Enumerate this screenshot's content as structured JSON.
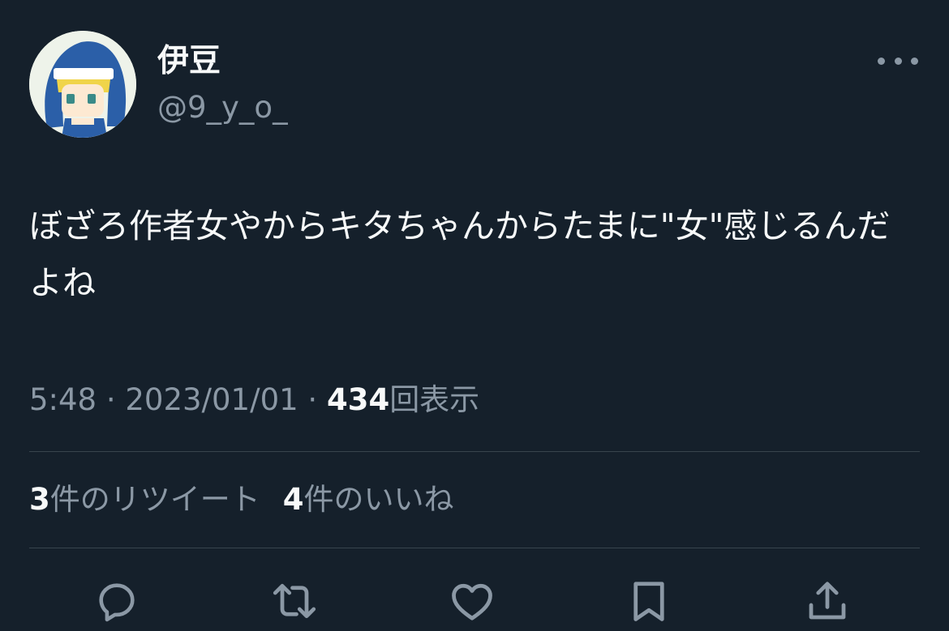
{
  "user": {
    "display_name": "伊豆",
    "handle": "@9_y_o_"
  },
  "tweet": {
    "text": "ぼざろ作者女やからキタちゃんからたまに\"女\"感じるんだよね",
    "time": "5:48",
    "separator": "·",
    "date": "2023/01/01",
    "views_count": "434",
    "views_label": "回表示"
  },
  "stats": {
    "retweets_count": "3",
    "retweets_label": "件のリツイート",
    "likes_count": "4",
    "likes_label": "件のいいね"
  },
  "actions": [
    "reply-icon",
    "retweet-icon",
    "like-icon",
    "bookmark-icon",
    "share-icon"
  ],
  "colors": {
    "background": "#15202b",
    "text_primary": "#f7f9f9",
    "text_secondary": "#8b98a5",
    "divider": "#38444d"
  }
}
